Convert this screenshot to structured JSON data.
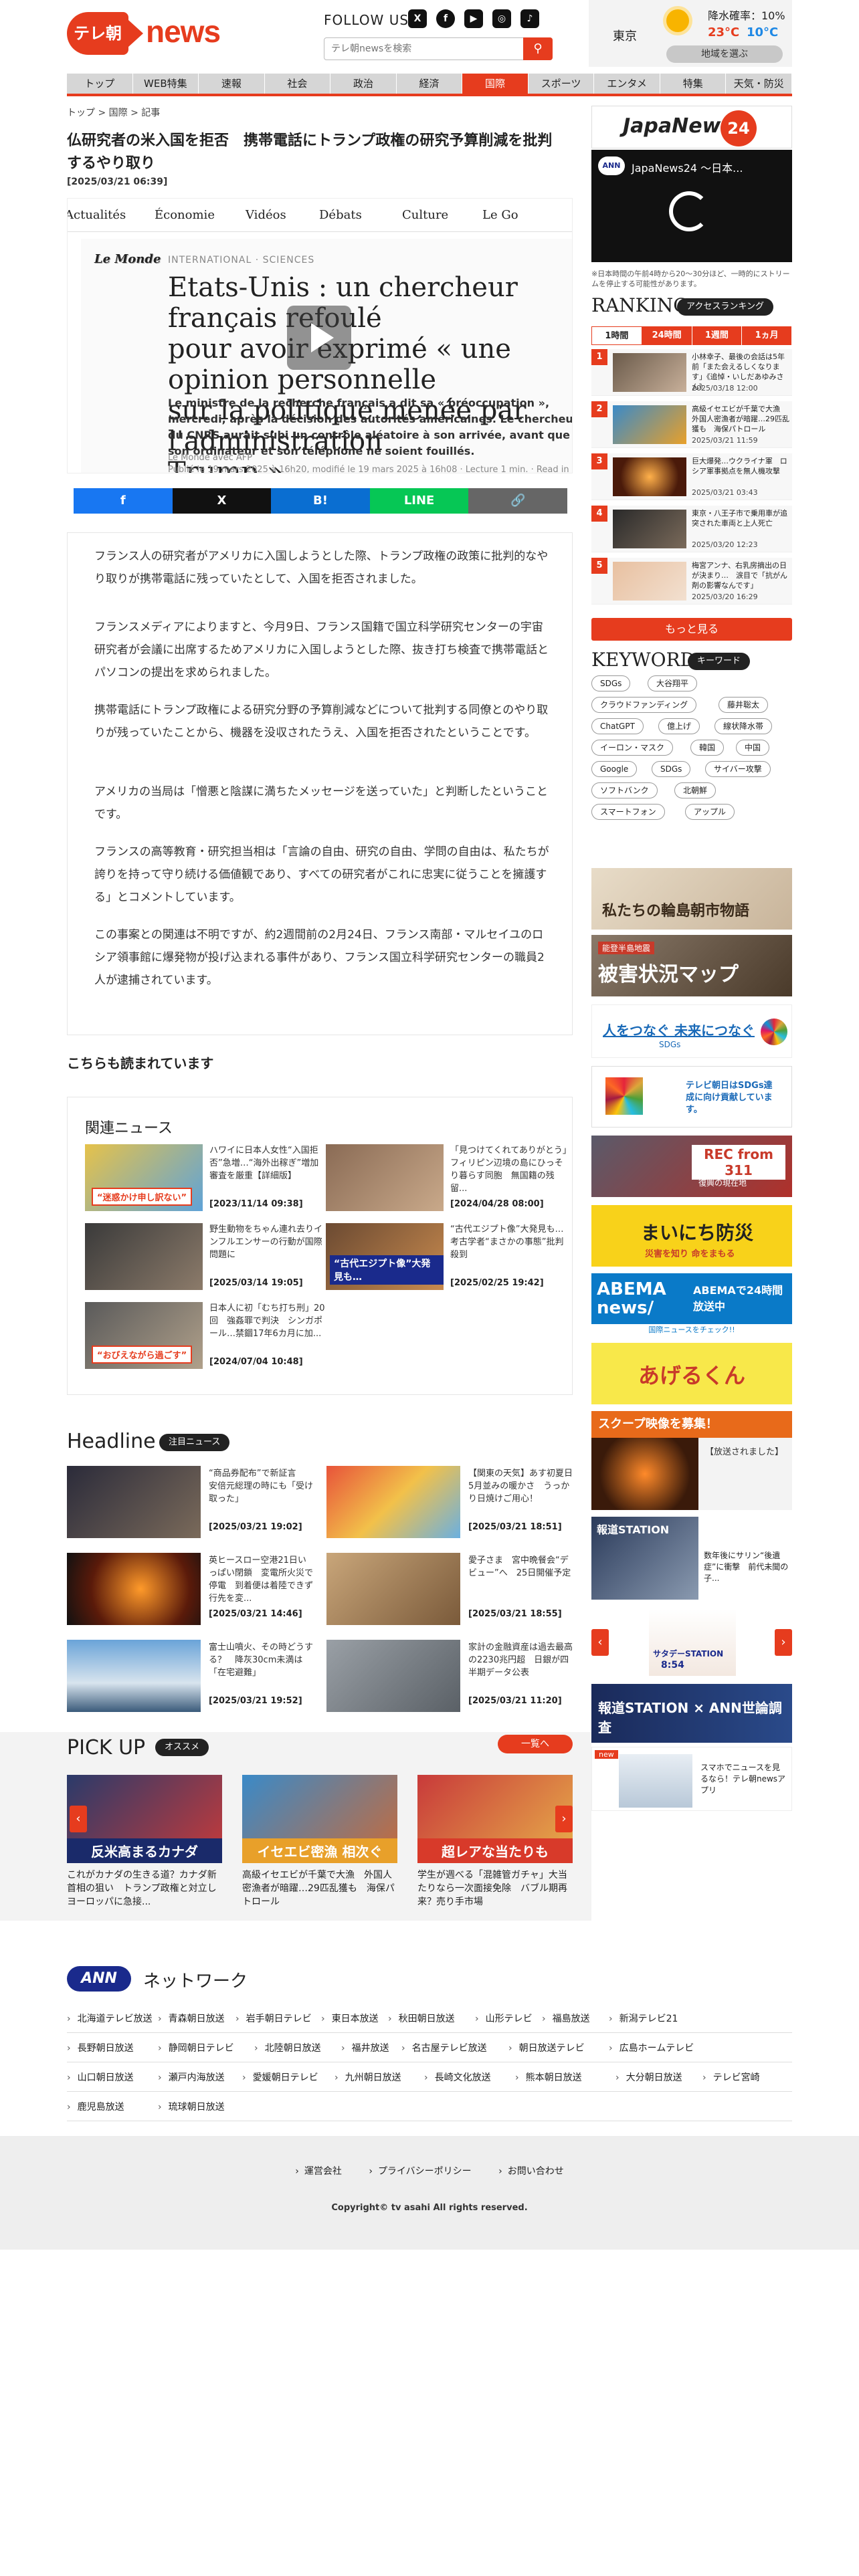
{
  "header": {
    "logo_badge": "テレ朝",
    "logo_news": "news",
    "follow_label": "FOLLOW US",
    "sns": [
      "X",
      "f",
      "▶",
      "◎",
      "♪"
    ],
    "search_placeholder": "テレ朝newsを検索",
    "search_icon": "search-icon"
  },
  "weather": {
    "pref": "東京",
    "rain": "降水確率：10%",
    "high": "23°C",
    "low": "10°C",
    "button": "地域を選ぶ"
  },
  "nav": [
    "トップ",
    "WEB特集",
    "速報",
    "社会",
    "政治",
    "経済",
    "国際",
    "スポーツ",
    "エンタメ",
    "特集",
    "天気・防災"
  ],
  "nav_active": 6,
  "breadcrumb": "トップ  >  国際  >  記事",
  "article": {
    "title": "仏研究者の米入国を拒否　携帯電話にトランプ政権の研究予算削減を批判するやり取り",
    "date": "[2025/03/21 06:39]",
    "embed": {
      "nav": [
        "Actualités",
        "Économie",
        "Vidéos",
        "Débats",
        "Culture",
        "Le Go"
      ],
      "brand": "Le Monde",
      "category": "INTERNATIONAL  ·  SCIENCES",
      "headline": "Etats-Unis : un chercheur français refoulé\npour avoir exprimé « une opinion personnelle\nsur la politique menée par l'administration\nTrump »",
      "lead": "Le ministre de la recherche français a dit sa « préoccupation », mercredi, après la décision des autorités américaines. Le chercheur du CNRS aurait subi un contrôle aléatoire à son arrivée, avant que son ordinateur et son téléphone ne soient fouillés.",
      "source": "Le Monde avec AFP",
      "published": "Publié le 19 mars 2025 à 16h20, modifié le 19 mars 2025 à 16h08  ·  Lecture 1 min.  ·  Read in English"
    },
    "share": [
      "f",
      "X",
      "B!",
      "LINE",
      "🔗"
    ],
    "paragraphs": [
      "フランス人の研究者がアメリカに入国しようとした際、トランプ政権の政策に批判的なやり取りが携帯電話に残っていたとして、入国を拒否されました。",
      "フランスメディアによりますと、今月9日、フランス国籍で国立科学研究センターの宇宙研究者が会議に出席するためアメリカに入国しようとした際、抜き打ち検査で携帯電話とパソコンの提出を求められました。",
      "携帯電話にトランプ政権による研究分野の予算削減などについて批判する同僚とのやり取りが残っていたことから、機器を没収されたうえ、入国を拒否されたということです。",
      "アメリカの当局は「憎悪と陰謀に満ちたメッセージを送っていた」と判断したということです。",
      "フランスの高等教育・研究担当相は「言論の自由、研究の自由、学問の自由は、私たちが誇りを持って守り続ける価値観であり、すべての研究者がこれに忠実に従うことを擁護する」とコメントしています。",
      "この事案との関連は不明ですが、約2週間前の2月24日、フランス南部・マルセイユのロシア領事館に爆発物が投げ込まれる事件があり、フランス国立科学研究センターの職員2人が逮捕されています。"
    ]
  },
  "also_read": "こちらも読まれています",
  "related": {
    "heading": "関連ニュース",
    "items": [
      {
        "title": "ハワイに日本人女性“入国拒否”急増…“海外出稼ぎ”増加　審査を厳重【詳細版】",
        "date": "[2023/11/14 09:38]",
        "caption": "“迷惑かけ申し訳ない”"
      },
      {
        "title": "「見つけてくれてありがとう」フィリピン辺境の島にひっそり暮らす同胞　無国籍の残留...",
        "date": "[2024/04/28 08:00]",
        "caption": ""
      },
      {
        "title": "野生動物をちゃん連れ去りインフルエンサーの行動が国際問題に",
        "date": "[2025/03/14 19:05]",
        "caption": ""
      },
      {
        "title": "“古代エジプト像”大発見も…考古学者“まさかの事態”批判殺到",
        "date": "[2025/02/25 19:42]",
        "caption": "“古代エジプト像”大発見も…"
      },
      {
        "title": "日本人に初「むち打ち刑」20回　強姦罪で判決　シンガポール…禁錮17年6カ月に加...",
        "date": "[2024/07/04 10:48]",
        "caption": "“おびえながら過ごす”"
      }
    ]
  },
  "headline": {
    "heading": "Headline",
    "pill": "注目ニュース",
    "items": [
      {
        "title": "“商品券配布”で新証言　安倍元総理の時にも「受け取った」",
        "date": "[2025/03/21 19:02]"
      },
      {
        "title": "【関東の天気】あす初夏日　5月並みの暖かさ　うっかり日焼けご用心！",
        "date": "[2025/03/21 18:51]"
      },
      {
        "title": "英ヒースロー空港21日いっぱい閉鎖　変電所火災で停電　到着便は着陸できず行先を変...",
        "date": "[2025/03/21 14:46]"
      },
      {
        "title": "愛子さま　宮中晩餐会“デビュー”へ　25日開催予定",
        "date": "[2025/03/21 18:55]"
      },
      {
        "title": "富士山噴火、その時どうする？　降灰30cm未満は「在宅避難」",
        "date": "[2025/03/21 19:52]"
      },
      {
        "title": "家計の金融資産は過去最高の2230兆円超　日銀が四半期データ公表",
        "date": "[2025/03/21 11:20]"
      }
    ]
  },
  "pickup": {
    "heading": "PICK UP",
    "pill": "オススメ",
    "more": "一覧へ",
    "items": [
      {
        "title": "これがカナダの生きる道？カナダ新首相の狙い　トランプ政権と対立しヨーロッパに急接...",
        "caption": "反米高まるカナダ"
      },
      {
        "title": "高級イセエビが千葉で大漁　外国人密漁者が暗躍…29匹乱獲も　海保パトロール",
        "caption": "イセエビ密漁 相次ぐ"
      },
      {
        "title": "学生が週べる「混雑管ガチャ」大当たりなら一次面接免除　バブル期再来？売り手市場",
        "caption": "超レアな当たりも"
      }
    ]
  },
  "network": {
    "logo": "ANN",
    "title": "ネットワーク",
    "rows": [
      [
        "北海道テレビ放送",
        "青森朝日放送",
        "岩手朝日テレビ",
        "東日本放送",
        "秋田朝日放送",
        "山形テレビ",
        "福島放送",
        "新潟テレビ21"
      ],
      [
        "長野朝日放送",
        "静岡朝日テレビ",
        "北陸朝日放送",
        "福井放送",
        "名古屋テレビ放送",
        "朝日放送テレビ",
        "広島ホームテレビ"
      ],
      [
        "山口朝日放送",
        "瀬戸内海放送",
        "愛媛朝日テレビ",
        "九州朝日放送",
        "長崎文化放送",
        "熊本朝日放送",
        "大分朝日放送",
        "テレビ宮崎"
      ],
      [
        "鹿児島放送",
        "琉球朝日放送"
      ]
    ]
  },
  "footer": {
    "links": [
      "運営会社",
      "プライバシーポリシー",
      "お問い合わせ"
    ],
    "copyright": "Copyright© tv asahi All rights reserved."
  },
  "sidebar": {
    "jn24_title": "JapaNews",
    "jn24_num": "24",
    "video_badge": "ANN",
    "video_title": "JapaNews24 ～日本...",
    "note": "※日本時間の午前4時から20～30分ほど、一時的にストリームを停止する可能性があります。",
    "ranking_heading": "RANKING",
    "ranking_pill": "アクセスランキング",
    "ranking_tabs": [
      "1時間",
      "24時間",
      "1週間",
      "1ヵ月"
    ],
    "ranking": [
      {
        "title": "小林幸子、最後の会話は5年前「また会えるしくなります」《追悼・いしだあゆみさん》",
        "date": "2025/03/18 12:00"
      },
      {
        "title": "高級イセエビが千葉で大漁　外国人密漁者が暗躍…29匹乱獲も　海保パトロール",
        "date": "2025/03/21 11:59"
      },
      {
        "title": "巨大爆発…ウクライナ軍　ロシア軍事拠点を無人機攻撃",
        "date": "2025/03/21 03:43"
      },
      {
        "title": "東京・八王子市で乗用車が追突された車両と上人死亡",
        "date": "2025/03/20 12:23"
      },
      {
        "title": "梅宮アンナ、右乳房摘出の日が決まり…　涙目で「抗がん剤の影響なんです」",
        "date": "2025/03/20 16:29"
      }
    ],
    "ranking_more": "もっと見る",
    "keyword_heading": "KEYWORD",
    "keyword_pill": "キーワード",
    "keywords": [
      [
        "SDGs",
        "大谷翔平"
      ],
      [
        "クラウドファンディング",
        "藤井聡太"
      ],
      [
        "ChatGPT",
        "億上げ",
        "線状降水帯"
      ],
      [
        "イーロン・マスク",
        "韓国",
        "中国"
      ],
      [
        "Google",
        "SDGs",
        "サイバー攻撃"
      ],
      [
        "ソフトバンク",
        "北朝鮮"
      ],
      [
        "スマートフォン",
        "アップル"
      ]
    ],
    "banners": {
      "wajima": "私たちの輪島朝市物語",
      "noto_small": "能登半島地震",
      "noto": "被害状況マップ",
      "sdgs": "人をつなぐ 未来につなぐ",
      "sdgs_sub": "SDGs",
      "sdgs_card": "テレビ朝日はSDGs達成に向け貢献しています。",
      "rec": "REC from 311",
      "rec_sub": "復興の現在地",
      "bousai": "まいにち防災",
      "bousai_sub": "災害を知り 命をまもる",
      "abema": "ABEMA news/",
      "abema_r": "ABEMAで24時間放送中",
      "abema_sub": "国際ニュースをチェック!!",
      "ageru": "あげるくん",
      "scoop": "スクープ映像を募集！",
      "scoop_sub": "【放送されました】",
      "hodo": "報道STATION",
      "hodo_t": "数年後にサリン“後遺症”に衝撃　前代未聞の子...",
      "saturday": "サタデーSTATION",
      "saturday_time": "8:54",
      "poll": "報道STATION × ANN世論調査",
      "app": "スマホでニュースを見るなら！テレ朝newsアプリ",
      "app_badge": "new"
    }
  }
}
